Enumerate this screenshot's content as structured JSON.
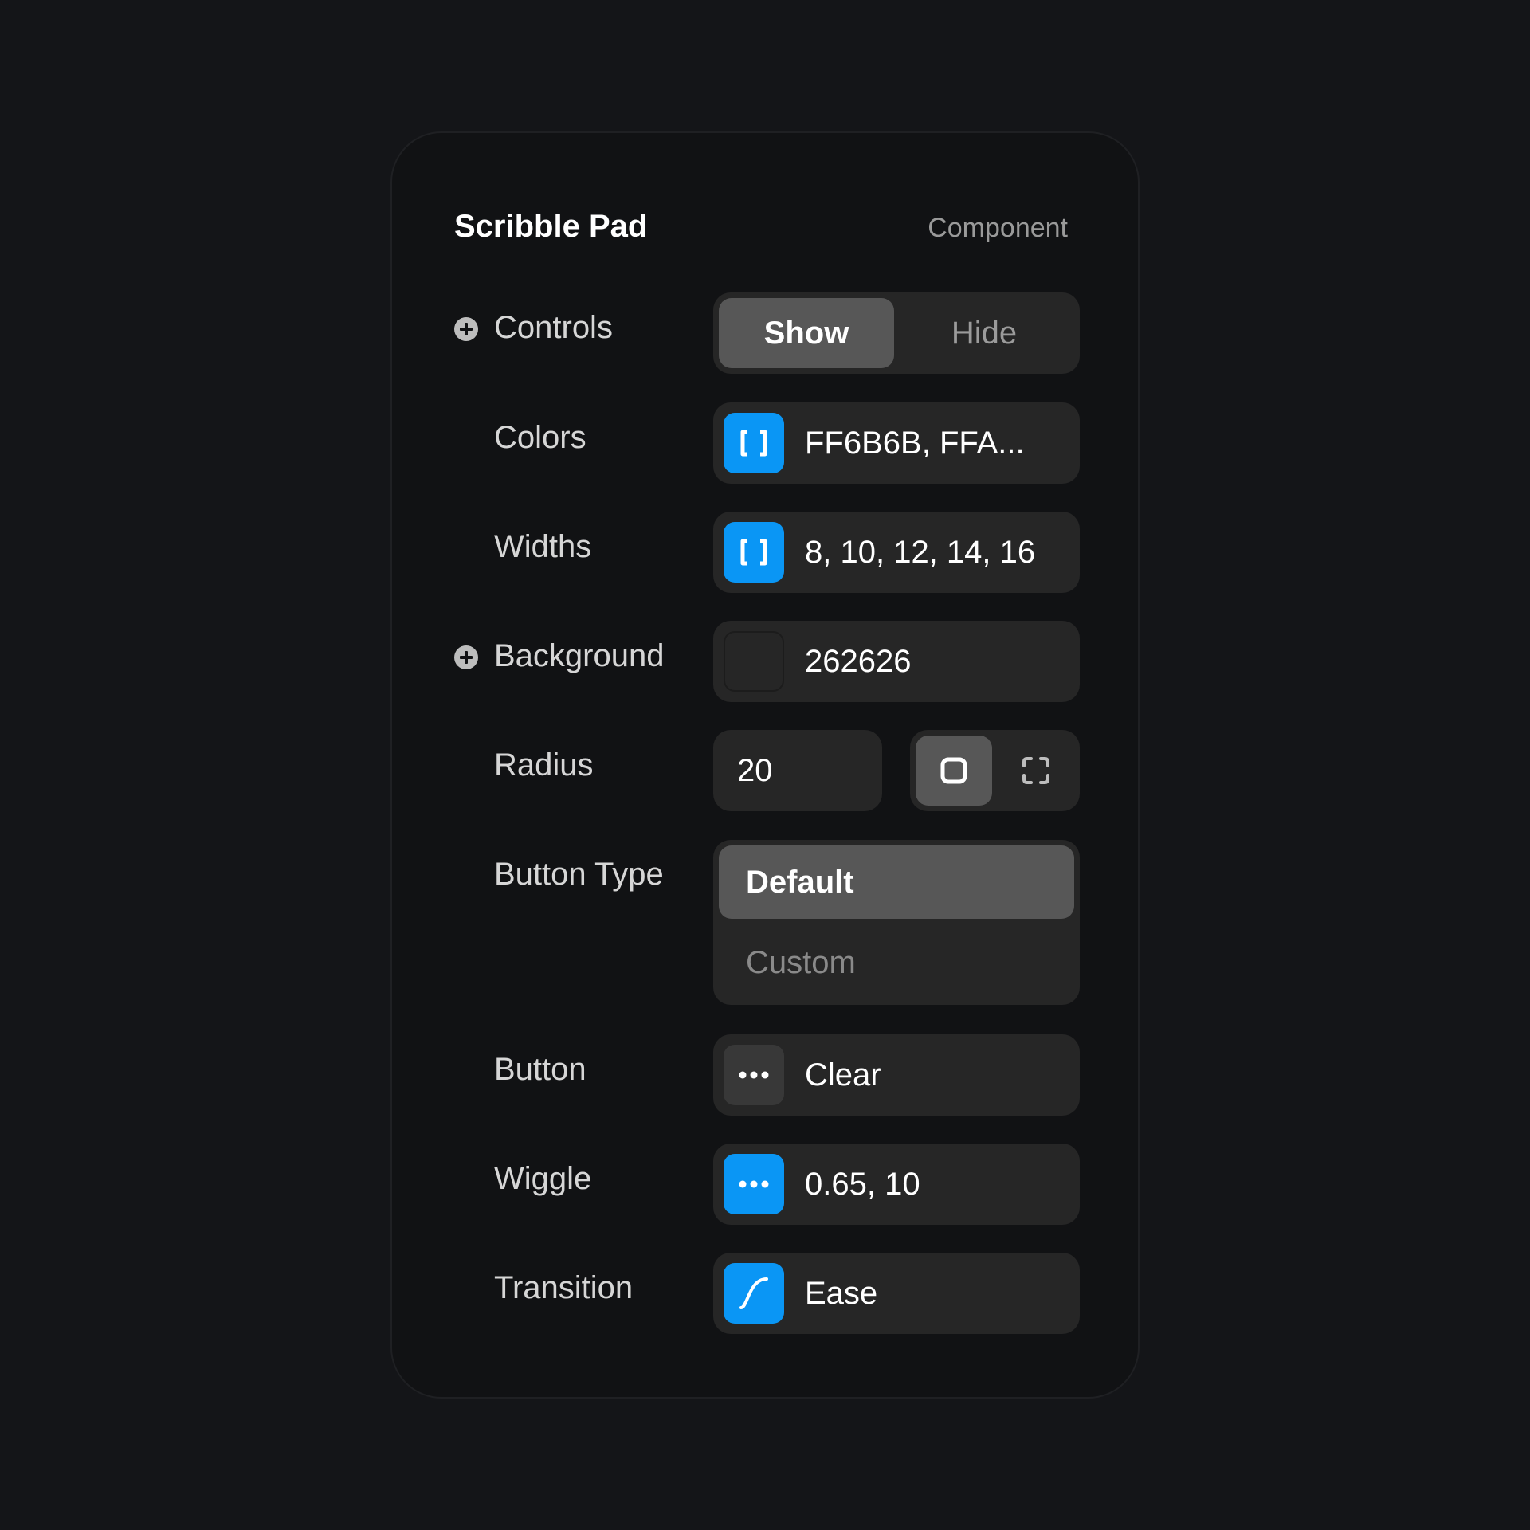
{
  "panel": {
    "title": "Scribble Pad",
    "subtitle": "Component"
  },
  "rows": {
    "controls": {
      "label": "Controls",
      "options": [
        "Show",
        "Hide"
      ],
      "selected": "Show",
      "icon": "plus-circle-icon"
    },
    "colors": {
      "label": "Colors",
      "value": "FF6B6B, FFA...",
      "icon": "array-brackets-icon"
    },
    "widths": {
      "label": "Widths",
      "value": "8, 10, 12, 14, 16",
      "icon": "array-brackets-icon"
    },
    "background": {
      "label": "Background",
      "value": "262626",
      "swatch": "#262626",
      "icon": "plus-circle-icon"
    },
    "radius": {
      "label": "Radius",
      "value": "20",
      "modes": [
        "rounded-square-icon",
        "corner-brackets-icon"
      ],
      "selected_mode": "rounded-square-icon"
    },
    "button_type": {
      "label": "Button Type",
      "options": [
        "Default",
        "Custom"
      ],
      "selected": "Default"
    },
    "button": {
      "label": "Button",
      "value": "Clear",
      "icon": "ellipsis-icon"
    },
    "wiggle": {
      "label": "Wiggle",
      "value": "0.65, 10",
      "icon": "ellipsis-icon"
    },
    "transition": {
      "label": "Transition",
      "value": "Ease",
      "icon": "ease-curve-icon"
    }
  },
  "colors": {
    "accent": "#0A96F5",
    "background": "#141518",
    "panel": "#111214",
    "field": "#262626",
    "active_segment": "#575757"
  }
}
